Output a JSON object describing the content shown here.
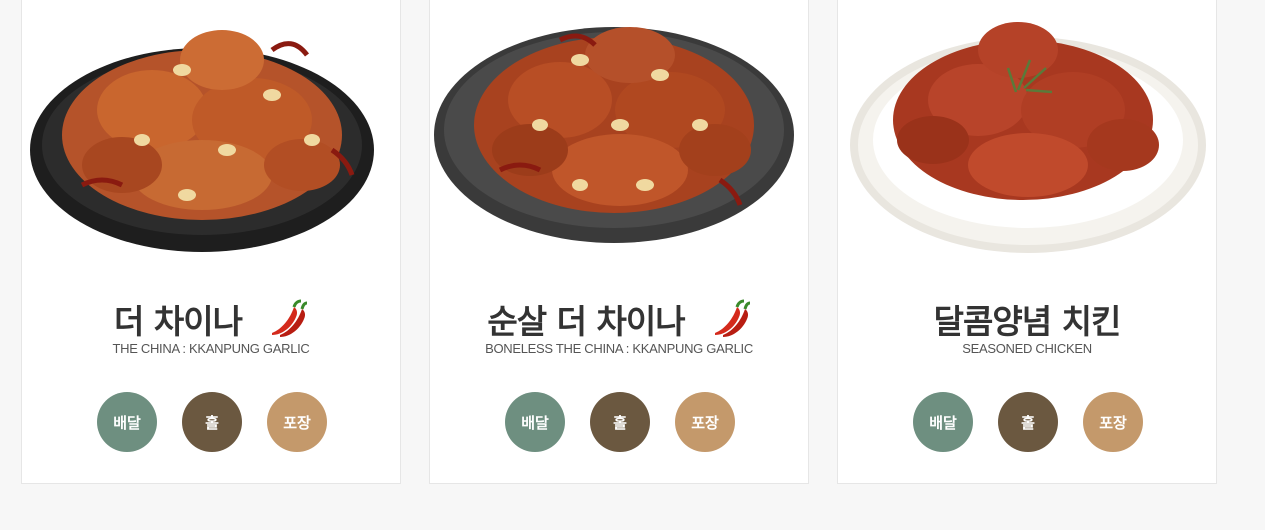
{
  "colors": {
    "delivery": "#6e8f80",
    "hall": "#6b5840",
    "takeout": "#c4996b",
    "title_text": "#333333",
    "subtitle_text": "#555555"
  },
  "buttons": {
    "delivery": "배달",
    "hall": "홀",
    "takeout": "포장"
  },
  "menu": [
    {
      "name": "더 차이나",
      "english": "THE CHINA : KKANPUNG GARLIC",
      "spicy": true,
      "plate": "black"
    },
    {
      "name": "순살 더 차이나",
      "english": "BONELESS THE CHINA : KKANPUNG GARLIC",
      "spicy": true,
      "plate": "dark-gray"
    },
    {
      "name": "달콤양념 치킨",
      "english": "SEASONED CHICKEN",
      "spicy": false,
      "plate": "white"
    }
  ],
  "icons": {
    "spicy": "chili-pepper-icon"
  }
}
